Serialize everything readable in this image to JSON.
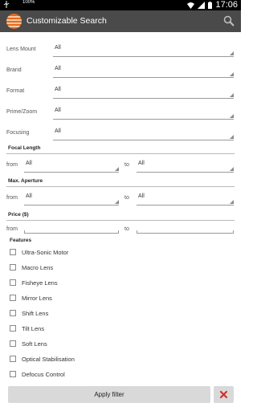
{
  "status_bar": {
    "time": "17:06",
    "battery_percent": "100%"
  },
  "app": {
    "title": "Customizable Search",
    "search_icon": "search-icon",
    "logo_icon": "lens-logo-icon"
  },
  "fields": [
    {
      "label": "Lens Mount",
      "value": "All"
    },
    {
      "label": "Brand",
      "value": "All"
    },
    {
      "label": "Format",
      "value": "All"
    },
    {
      "label": "Prime/Zoom",
      "value": "All"
    },
    {
      "label": "Focusing",
      "value": "All"
    }
  ],
  "focal_length": {
    "title": "Focal Length",
    "from_label": "from",
    "from_value": "All",
    "to_label": "to",
    "to_value": "All"
  },
  "aperture": {
    "title": "Max. Aperture",
    "from_label": "from",
    "from_value": "All",
    "to_label": "to",
    "to_value": "All"
  },
  "price": {
    "title": "Price ($)",
    "from_label": "from",
    "from_value": "",
    "to_label": "to",
    "to_value": ""
  },
  "features": {
    "title": "Features",
    "items": [
      {
        "label": "Ultra-Sonic Motor",
        "checked": false
      },
      {
        "label": "Macro Lens",
        "checked": false
      },
      {
        "label": "Fisheye Lens",
        "checked": false
      },
      {
        "label": "Mirror Lens",
        "checked": false
      },
      {
        "label": "Shift Lens",
        "checked": false
      },
      {
        "label": "Tilt Lens",
        "checked": false
      },
      {
        "label": "Soft Lens",
        "checked": false
      },
      {
        "label": "Optical Stabilisation",
        "checked": false
      },
      {
        "label": "Defocus Control",
        "checked": false
      }
    ]
  },
  "actions": {
    "apply_label": "Apply filter",
    "clear_icon": "close-icon",
    "clear_color": "#d32f2f"
  }
}
